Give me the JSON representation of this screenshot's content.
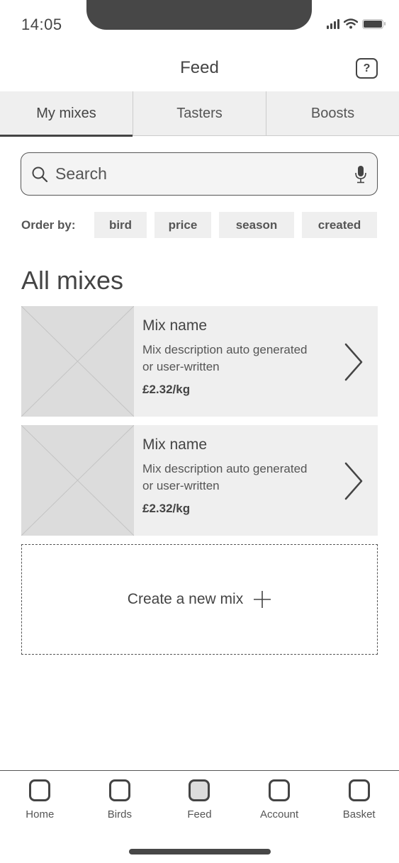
{
  "status_bar": {
    "time": "14:05",
    "icons": [
      "cellular-signal-icon",
      "wifi-icon",
      "battery-icon"
    ]
  },
  "header": {
    "title": "Feed",
    "help_label": "?"
  },
  "tabs": [
    {
      "label": "My mixes",
      "active": true
    },
    {
      "label": "Tasters",
      "active": false
    },
    {
      "label": "Boosts",
      "active": false
    }
  ],
  "search": {
    "placeholder": "Search",
    "icons": [
      "search-icon",
      "microphone-icon"
    ]
  },
  "order_by": {
    "label": "Order by:",
    "options": [
      "bird",
      "price",
      "season",
      "created"
    ]
  },
  "section": {
    "title": "All mixes"
  },
  "mixes": [
    {
      "name": "Mix name",
      "description": "Mix description auto generated or user-written",
      "price": "£2.32/kg"
    },
    {
      "name": "Mix name",
      "description": "Mix description auto generated or user-written",
      "price": "£2.32/kg"
    }
  ],
  "create": {
    "label": "Create a new mix"
  },
  "bottom_nav": [
    {
      "label": "Home",
      "active": false
    },
    {
      "label": "Birds",
      "active": false
    },
    {
      "label": "Feed",
      "active": true
    },
    {
      "label": "Account",
      "active": false
    },
    {
      "label": "Basket",
      "active": false
    }
  ],
  "colors": {
    "primary_text": "#444444",
    "surface": "#efefef",
    "placeholder": "#dcdcdc"
  }
}
